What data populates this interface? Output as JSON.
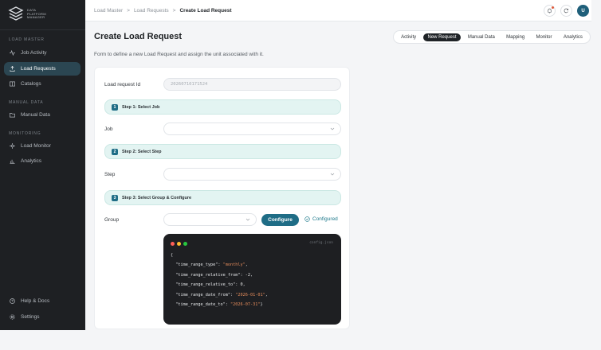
{
  "logo": {
    "line1": "DATA",
    "line2": "PLATFORM",
    "line3": "MANAGER"
  },
  "sidebar": {
    "sections": [
      {
        "title": "LOAD MASTER"
      },
      {
        "title": "MANUAL DATA"
      },
      {
        "title": "MONITORING"
      }
    ],
    "items": [
      {
        "label": "Job Activity",
        "icon": "activity-icon"
      },
      {
        "label": "Load Requests",
        "icon": "upload-icon"
      },
      {
        "label": "Catalogs",
        "icon": "catalog-icon"
      },
      {
        "label": "Manual Data",
        "icon": "folder-icon"
      },
      {
        "label": "Load Monitor",
        "icon": "monitor-icon"
      },
      {
        "label": "Analytics",
        "icon": "analytics-icon"
      },
      {
        "label": "Help & Docs",
        "icon": "help-icon"
      },
      {
        "label": "Settings",
        "icon": "gear-icon"
      }
    ]
  },
  "breadcrumb": {
    "c1": "Load Master",
    "c2": "Load Requests",
    "c3": "Create Load Request",
    "sep": ">"
  },
  "user": {
    "initial": "U"
  },
  "page": {
    "title": "Create Load Request",
    "subtitle": "Form to define a new Load Request and assign the unit associated with it."
  },
  "tabs": [
    "Activity",
    "New Request",
    "Manual Data",
    "Mapping",
    "Monitor",
    "Analytics"
  ],
  "form": {
    "request_id_label": "Load request Id",
    "request_id_value": "20260710171524",
    "step1": {
      "num": "1",
      "label": "Step 1: Select Job"
    },
    "job_label": "Job",
    "step2": {
      "num": "2",
      "label": "Step 2: Select Step"
    },
    "step_label": "Step",
    "step3": {
      "num": "3",
      "label": "Step 3: Select Group & Configure"
    },
    "group_label": "Group",
    "configure_button": "Configure",
    "configured_label": "Configured"
  },
  "code": {
    "filename": "config.json",
    "open_brace": "{",
    "close_brace": "}",
    "entries": [
      {
        "key": "\"time_range_type\"",
        "value": "\"monthly\"",
        "type": "string",
        "sep": ": ",
        "comma": ","
      },
      {
        "key": "\"time_range_relative_from\"",
        "value": "-2",
        "type": "number",
        "sep": ": ",
        "comma": ","
      },
      {
        "key": "\"time_range_relative_to\"",
        "value": "0",
        "type": "number",
        "sep": ": ",
        "comma": ","
      },
      {
        "key": "\"time_range_date_from\"",
        "value": "\"2026-01-01\"",
        "type": "string",
        "sep": ": ",
        "comma": ","
      },
      {
        "key": "\"time_range_date_to\"",
        "value": "\"2026-07-31\"",
        "type": "string",
        "sep": ": ",
        "comma": ""
      }
    ]
  },
  "colors": {
    "accent": "#1f6d86",
    "sidebar_bg": "#1e2023",
    "active_nav": "#2b4652",
    "step_bg": "#e3f4f2",
    "code_bg": "#1e1f22",
    "dot_red": "#ff5f57",
    "dot_yellow": "#febc2e",
    "dot_green": "#28c840"
  }
}
